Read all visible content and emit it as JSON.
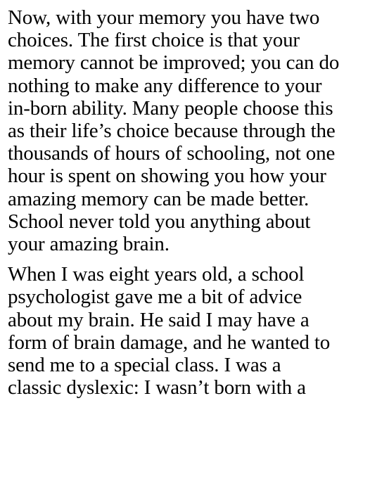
{
  "paragraphs": [
    {
      "lines": [
        "Now, with your memory you have two",
        "choices. The first choice is that your",
        "memory cannot be improved; you can do",
        "nothing to make any difference to your",
        "in-born ability. Many people choose this",
        "as their life’s choice because through the",
        "thousands of hours of schooling, not one",
        "hour is spent on showing you how your",
        "amazing memory can be made better.",
        "School never told you anything about",
        "your amazing brain."
      ]
    },
    {
      "lines": [
        "When I was eight years old, a school",
        "psychologist gave me a bit of advice",
        "about my brain. He said I may have a",
        "form of brain damage, and he wanted to",
        "send me to a special class. I was a",
        "classic dyslexic: I wasn’t born with a"
      ]
    }
  ]
}
